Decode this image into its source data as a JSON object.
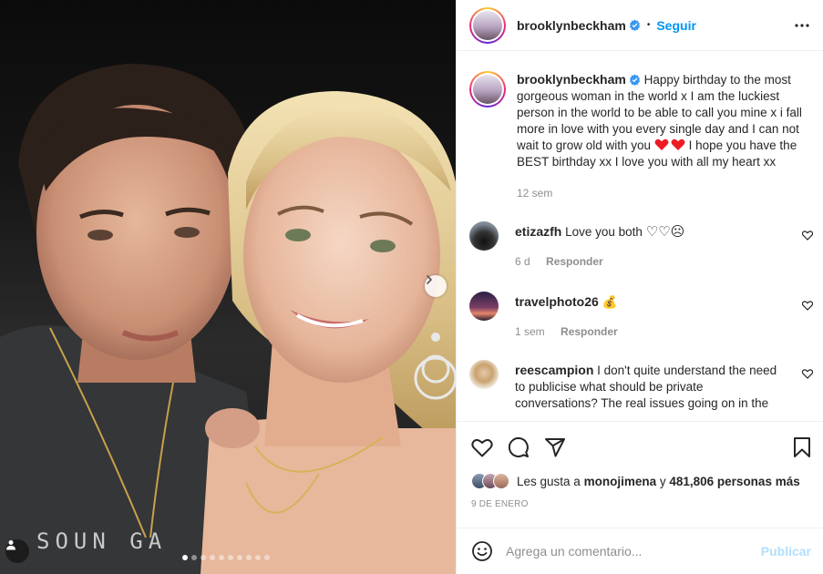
{
  "post": {
    "author": "brooklynbeckham",
    "follow_label": "Seguir",
    "separator": "•",
    "slide_count": 10,
    "active_slide": 1
  },
  "caption": {
    "username": "brooklynbeckham",
    "text_part1": "Happy birthday to the most gorgeous woman in the world x I am the luckiest person in the world to be able to call you mine x i fall more in love with you every single day and I can not wait to grow old with you",
    "text_part2": "I hope you have the BEST birthday xx I love you with all my heart xx",
    "time": "12 sem"
  },
  "comments": [
    {
      "username": "etizazfh",
      "text": "Love you both",
      "emoji": "♡♡☹",
      "time": "6 d",
      "reply_label": "Responder"
    },
    {
      "username": "travelphoto26",
      "text": "",
      "emoji": "💰",
      "time": "1 sem",
      "reply_label": "Responder"
    },
    {
      "username": "reescampion",
      "text": "I don't quite understand the need to publicise what should be private conversations? The real issues going on in the",
      "emoji": "",
      "time": "",
      "reply_label": ""
    }
  ],
  "likes": {
    "prefix": "Les gusta a",
    "user": "monojimena",
    "connector": "y",
    "count": "481,806 personas más"
  },
  "date": "9 DE ENERO",
  "add_comment": {
    "placeholder": "Agrega un comentario...",
    "post_label": "Publicar"
  },
  "colors": {
    "accent": "#0095f6",
    "post_disabled": "#b2dffc",
    "heart_red": "#ed1c24",
    "muted": "#8e8e8e"
  }
}
